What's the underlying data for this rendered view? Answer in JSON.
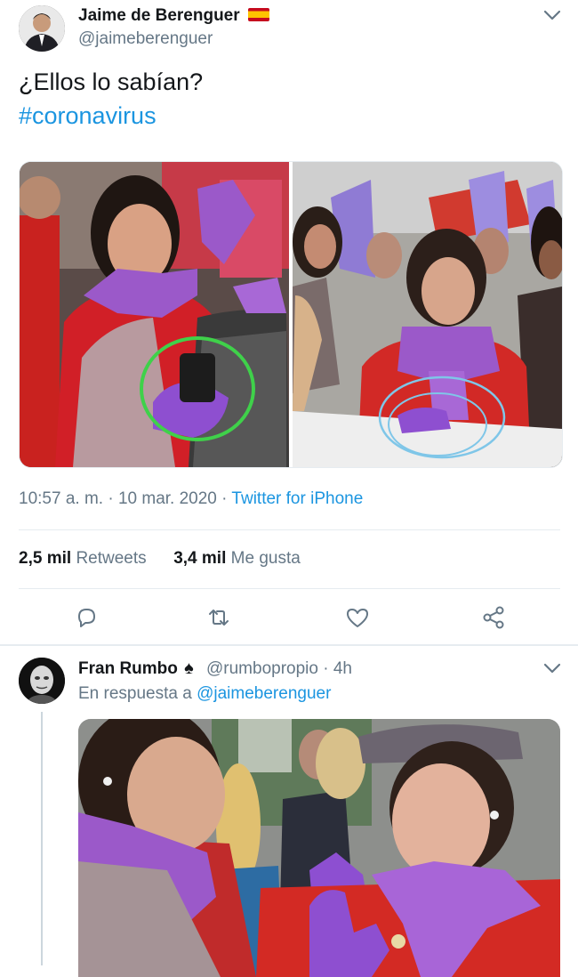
{
  "tweet": {
    "author_name": "Jaime de Berenguer",
    "author_flag": "🇪🇸",
    "handle": "@jaimeberenguer",
    "text_line1": "¿Ellos lo sabían?",
    "hashtag": "#coronavirus",
    "time": "10:57 a. m.",
    "date": "10 mar. 2020",
    "dot": "·",
    "source": "Twitter for iPhone",
    "retweets_count": "2,5 mil",
    "retweets_label": "Retweets",
    "likes_count": "3,4 mil",
    "likes_label": "Me gusta"
  },
  "reply": {
    "author_name": "Fran Rumbo",
    "author_badge": "♠",
    "handle": "@rumbopropio",
    "dot": "·",
    "age": "4h",
    "in_reply_prefix": "En respuesta a",
    "in_reply_handle": "@jaimeberenguer"
  },
  "icons": {
    "chevron": "chevron-down-icon",
    "reply": "reply-icon",
    "retweet": "retweet-icon",
    "like": "like-icon",
    "share": "share-icon"
  },
  "colors": {
    "link": "#1b95e0",
    "secondary_text": "#657786",
    "divider": "#e6ecf0",
    "purple_scarf": "#9b59c9",
    "green_circle": "#3fd14a",
    "blue_circle": "#7fc6e8"
  }
}
